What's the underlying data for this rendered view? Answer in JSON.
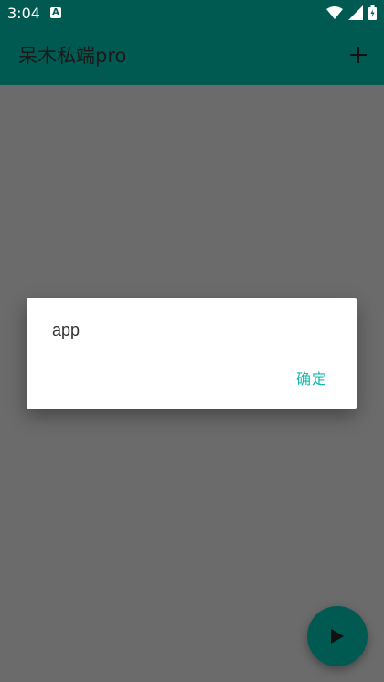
{
  "status_bar": {
    "time": "3:04",
    "a_icon_letter": "A",
    "icons": [
      "a-notification-icon",
      "wifi-icon",
      "signal-icon",
      "battery-icon"
    ]
  },
  "app_bar": {
    "title": "呆木私端pro",
    "add_icon": "add-icon"
  },
  "dialog": {
    "message": "app",
    "ok_label": "确定"
  },
  "fab": {
    "icon": "play-icon"
  },
  "colors": {
    "primary": "#005a52",
    "accent": "#14b7aa",
    "scrim_background": "#6b6b6b",
    "dialog_background": "#ffffff"
  }
}
